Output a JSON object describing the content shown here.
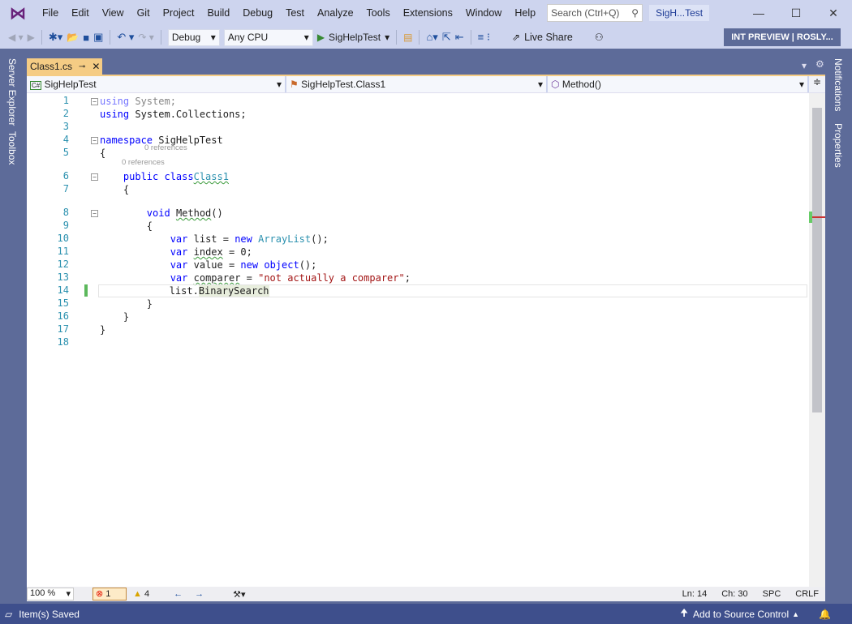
{
  "title_bar": {
    "menus": [
      "File",
      "Edit",
      "View",
      "Git",
      "Project",
      "Build",
      "Debug",
      "Test",
      "Analyze",
      "Tools",
      "Extensions",
      "Window",
      "Help"
    ],
    "search_placeholder": "Search (Ctrl+Q)",
    "solution_title": "SigH...Test",
    "minimize": "—",
    "maximize": "☐",
    "close": "✕"
  },
  "toolbar": {
    "config": "Debug",
    "platform": "Any CPU",
    "start_label": "SigHelpTest",
    "live_share": "Live Share",
    "int_preview": "INT PREVIEW | ROSLY..."
  },
  "left_tabs": [
    "Server Explorer",
    "Toolbox"
  ],
  "right_tabs": [
    "Notifications",
    "Properties"
  ],
  "doc_tab": {
    "name": "Class1.cs"
  },
  "navbar": {
    "project": "SigHelpTest",
    "type": "SigHelpTest.Class1",
    "member": "Method()"
  },
  "code": {
    "lens": "0 references",
    "lines": [
      {
        "n": "1",
        "t": [
          [
            "kw dim",
            "using"
          ],
          [
            "dim",
            " System;"
          ]
        ]
      },
      {
        "n": "2",
        "t": [
          [
            "kw",
            "using"
          ],
          [
            "",
            " System.Collections;"
          ]
        ]
      },
      {
        "n": "3",
        "t": []
      },
      {
        "n": "4",
        "t": [
          [
            "kw",
            "namespace"
          ],
          [
            "",
            " SigHelpTest"
          ]
        ]
      },
      {
        "n": "5",
        "t": [
          [
            "",
            "{"
          ]
        ]
      },
      {
        "n": "6",
        "t": [
          [
            "",
            "    "
          ],
          [
            "kw",
            "public class"
          ],
          [
            "",
            "",
            " "
          ],
          [
            "ty sq",
            "Class1"
          ]
        ]
      },
      {
        "n": "7",
        "t": [
          [
            "",
            "    {"
          ]
        ]
      },
      {
        "n": "8",
        "t": [
          [
            "",
            "        "
          ],
          [
            "kw",
            "void"
          ],
          [
            "",
            " "
          ],
          [
            "sq",
            "Method"
          ],
          [
            "",
            "()"
          ]
        ]
      },
      {
        "n": "9",
        "t": [
          [
            "",
            "        {"
          ]
        ]
      },
      {
        "n": "10",
        "t": [
          [
            "",
            "            "
          ],
          [
            "kw",
            "var"
          ],
          [
            "",
            " list = "
          ],
          [
            "kw",
            "new"
          ],
          [
            "",
            " "
          ],
          [
            "ty",
            "ArrayList"
          ],
          [
            "",
            "();"
          ]
        ]
      },
      {
        "n": "11",
        "t": [
          [
            "",
            "            "
          ],
          [
            "kw",
            "var"
          ],
          [
            "",
            " "
          ],
          [
            "sq",
            "index"
          ],
          [
            "",
            " = 0;"
          ]
        ]
      },
      {
        "n": "12",
        "t": [
          [
            "",
            "            "
          ],
          [
            "kw",
            "var"
          ],
          [
            "",
            " value = "
          ],
          [
            "kw",
            "new"
          ],
          [
            "",
            " "
          ],
          [
            "kw",
            "object"
          ],
          [
            "",
            "();"
          ]
        ]
      },
      {
        "n": "13",
        "t": [
          [
            "",
            "            "
          ],
          [
            "kw",
            "var"
          ],
          [
            "",
            " "
          ],
          [
            "sq",
            "comparer"
          ],
          [
            "",
            " = "
          ],
          [
            "st",
            "\"not actually a comparer\""
          ],
          [
            "",
            ";"
          ]
        ]
      },
      {
        "n": "14",
        "t": [
          [
            "",
            "            list."
          ],
          [
            "",
            "BinarySearch"
          ]
        ]
      },
      {
        "n": "15",
        "t": [
          [
            "",
            "        }"
          ]
        ]
      },
      {
        "n": "16",
        "t": [
          [
            "",
            "    }"
          ]
        ]
      },
      {
        "n": "17",
        "t": [
          [
            "",
            "}"
          ]
        ]
      },
      {
        "n": "18",
        "t": []
      }
    ]
  },
  "bottom_bar": {
    "zoom": "100 %",
    "errors": "1",
    "warnings": "4",
    "line": "Ln: 14",
    "col": "Ch: 30",
    "spaces": "SPC",
    "eol": "CRLF"
  },
  "status_bar": {
    "message": "Item(s) Saved",
    "source_control": "Add to Source Control"
  }
}
